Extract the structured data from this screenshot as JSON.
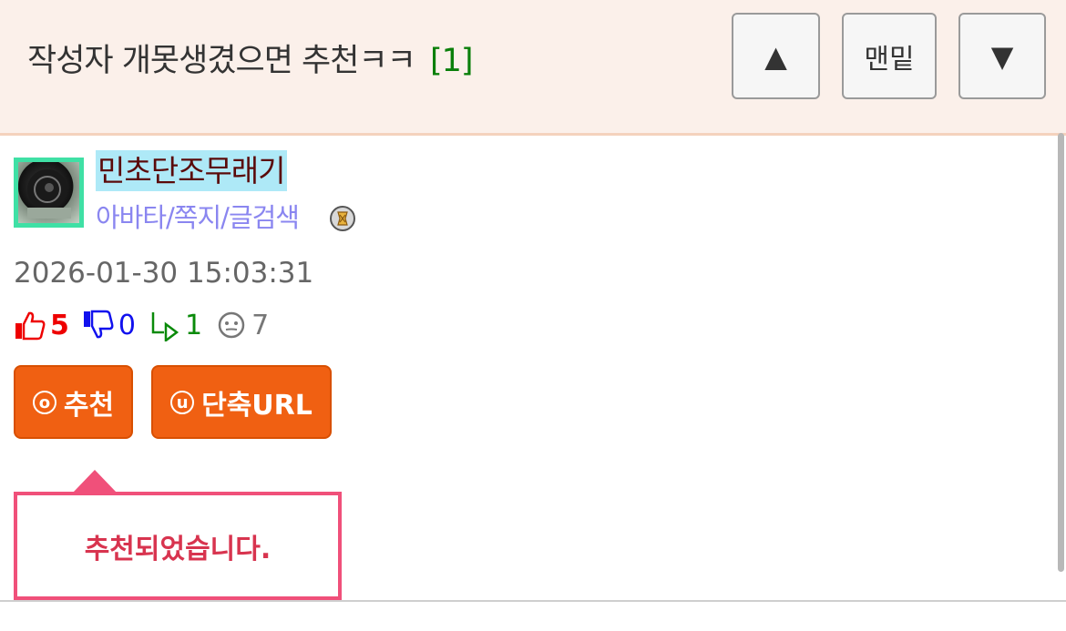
{
  "header": {
    "title": "작성자 개못생겼으면 추천ㅋㅋ",
    "comment_count": "[1]",
    "up_label": "▲",
    "bottom_label": "맨밑",
    "down_label": "▼"
  },
  "author": {
    "nickname": "민초단조무래기",
    "links": "아바타/쪽지/글검색",
    "avatar_icon": "avatar-image",
    "badge_icon": "level-badge-icon"
  },
  "post": {
    "date": "2026-01-30 15:03:31",
    "likes": "5",
    "dislikes": "0",
    "replies": "1",
    "views": "7"
  },
  "actions": {
    "recommend_icon": "ⓞ",
    "recommend_label": "추천",
    "shorturl_icon": "ⓤ",
    "shorturl_label": "단축URL"
  },
  "tooltip": {
    "message": "추천되었습니다."
  },
  "colors": {
    "header_bg": "#fbf0ea",
    "accent_orange": "#f06012",
    "tooltip_pink": "#f0507a",
    "nick_highlight": "#aee9f7",
    "like_red": "#ee0000",
    "dislike_blue": "#1111ee",
    "reply_green": "#0a8a0a"
  }
}
